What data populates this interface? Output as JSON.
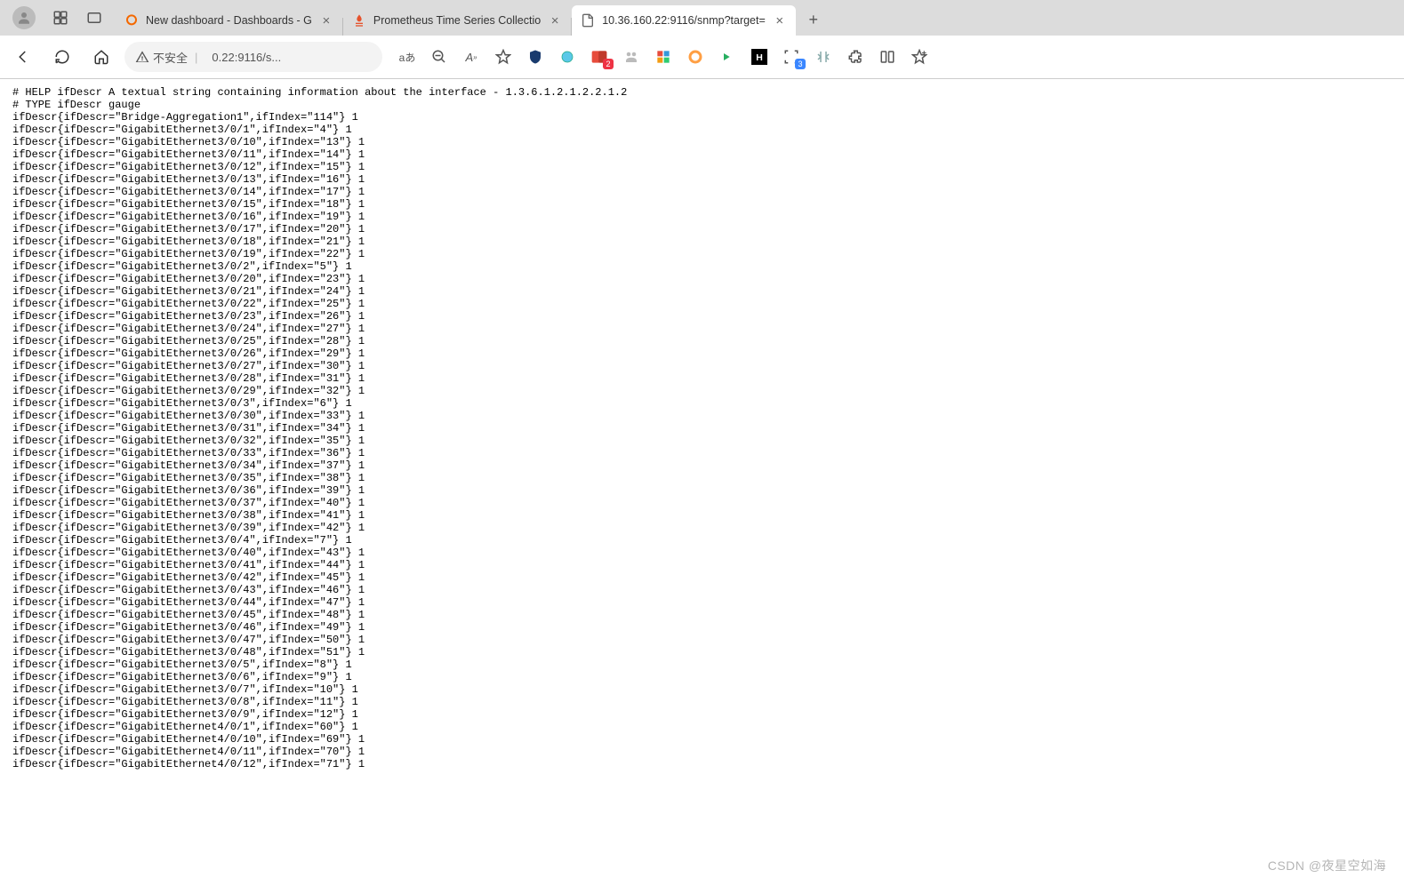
{
  "tabs": [
    {
      "title": "New dashboard - Dashboards - G",
      "favicon": "grafana"
    },
    {
      "title": "Prometheus Time Series Collectio",
      "favicon": "prometheus"
    },
    {
      "title": "10.36.160.22:9116/snmp?target=",
      "favicon": "page",
      "active": true
    }
  ],
  "addressBar": {
    "warning": "不安全",
    "urlHidden": "   ",
    "urlVisible": "0.22:9116/s..."
  },
  "toolbarIcons": {
    "lang": "aあ"
  },
  "extBadges": {
    "red": "2",
    "blue": "3"
  },
  "metrics": {
    "helpLine": "# HELP ifDescr A textual string containing information about the interface - 1.3.6.1.2.1.2.2.1.2",
    "typeLine": "# TYPE ifDescr gauge",
    "entries": [
      {
        "ifDescr": "Bridge-Aggregation1",
        "ifIndex": "114",
        "value": "1"
      },
      {
        "ifDescr": "GigabitEthernet3/0/1",
        "ifIndex": "4",
        "value": "1"
      },
      {
        "ifDescr": "GigabitEthernet3/0/10",
        "ifIndex": "13",
        "value": "1"
      },
      {
        "ifDescr": "GigabitEthernet3/0/11",
        "ifIndex": "14",
        "value": "1"
      },
      {
        "ifDescr": "GigabitEthernet3/0/12",
        "ifIndex": "15",
        "value": "1"
      },
      {
        "ifDescr": "GigabitEthernet3/0/13",
        "ifIndex": "16",
        "value": "1"
      },
      {
        "ifDescr": "GigabitEthernet3/0/14",
        "ifIndex": "17",
        "value": "1"
      },
      {
        "ifDescr": "GigabitEthernet3/0/15",
        "ifIndex": "18",
        "value": "1"
      },
      {
        "ifDescr": "GigabitEthernet3/0/16",
        "ifIndex": "19",
        "value": "1"
      },
      {
        "ifDescr": "GigabitEthernet3/0/17",
        "ifIndex": "20",
        "value": "1"
      },
      {
        "ifDescr": "GigabitEthernet3/0/18",
        "ifIndex": "21",
        "value": "1"
      },
      {
        "ifDescr": "GigabitEthernet3/0/19",
        "ifIndex": "22",
        "value": "1"
      },
      {
        "ifDescr": "GigabitEthernet3/0/2",
        "ifIndex": "5",
        "value": "1"
      },
      {
        "ifDescr": "GigabitEthernet3/0/20",
        "ifIndex": "23",
        "value": "1"
      },
      {
        "ifDescr": "GigabitEthernet3/0/21",
        "ifIndex": "24",
        "value": "1"
      },
      {
        "ifDescr": "GigabitEthernet3/0/22",
        "ifIndex": "25",
        "value": "1"
      },
      {
        "ifDescr": "GigabitEthernet3/0/23",
        "ifIndex": "26",
        "value": "1"
      },
      {
        "ifDescr": "GigabitEthernet3/0/24",
        "ifIndex": "27",
        "value": "1"
      },
      {
        "ifDescr": "GigabitEthernet3/0/25",
        "ifIndex": "28",
        "value": "1"
      },
      {
        "ifDescr": "GigabitEthernet3/0/26",
        "ifIndex": "29",
        "value": "1"
      },
      {
        "ifDescr": "GigabitEthernet3/0/27",
        "ifIndex": "30",
        "value": "1"
      },
      {
        "ifDescr": "GigabitEthernet3/0/28",
        "ifIndex": "31",
        "value": "1"
      },
      {
        "ifDescr": "GigabitEthernet3/0/29",
        "ifIndex": "32",
        "value": "1"
      },
      {
        "ifDescr": "GigabitEthernet3/0/3",
        "ifIndex": "6",
        "value": "1"
      },
      {
        "ifDescr": "GigabitEthernet3/0/30",
        "ifIndex": "33",
        "value": "1"
      },
      {
        "ifDescr": "GigabitEthernet3/0/31",
        "ifIndex": "34",
        "value": "1"
      },
      {
        "ifDescr": "GigabitEthernet3/0/32",
        "ifIndex": "35",
        "value": "1"
      },
      {
        "ifDescr": "GigabitEthernet3/0/33",
        "ifIndex": "36",
        "value": "1"
      },
      {
        "ifDescr": "GigabitEthernet3/0/34",
        "ifIndex": "37",
        "value": "1"
      },
      {
        "ifDescr": "GigabitEthernet3/0/35",
        "ifIndex": "38",
        "value": "1"
      },
      {
        "ifDescr": "GigabitEthernet3/0/36",
        "ifIndex": "39",
        "value": "1"
      },
      {
        "ifDescr": "GigabitEthernet3/0/37",
        "ifIndex": "40",
        "value": "1"
      },
      {
        "ifDescr": "GigabitEthernet3/0/38",
        "ifIndex": "41",
        "value": "1"
      },
      {
        "ifDescr": "GigabitEthernet3/0/39",
        "ifIndex": "42",
        "value": "1"
      },
      {
        "ifDescr": "GigabitEthernet3/0/4",
        "ifIndex": "7",
        "value": "1"
      },
      {
        "ifDescr": "GigabitEthernet3/0/40",
        "ifIndex": "43",
        "value": "1"
      },
      {
        "ifDescr": "GigabitEthernet3/0/41",
        "ifIndex": "44",
        "value": "1"
      },
      {
        "ifDescr": "GigabitEthernet3/0/42",
        "ifIndex": "45",
        "value": "1"
      },
      {
        "ifDescr": "GigabitEthernet3/0/43",
        "ifIndex": "46",
        "value": "1"
      },
      {
        "ifDescr": "GigabitEthernet3/0/44",
        "ifIndex": "47",
        "value": "1"
      },
      {
        "ifDescr": "GigabitEthernet3/0/45",
        "ifIndex": "48",
        "value": "1"
      },
      {
        "ifDescr": "GigabitEthernet3/0/46",
        "ifIndex": "49",
        "value": "1"
      },
      {
        "ifDescr": "GigabitEthernet3/0/47",
        "ifIndex": "50",
        "value": "1"
      },
      {
        "ifDescr": "GigabitEthernet3/0/48",
        "ifIndex": "51",
        "value": "1"
      },
      {
        "ifDescr": "GigabitEthernet3/0/5",
        "ifIndex": "8",
        "value": "1"
      },
      {
        "ifDescr": "GigabitEthernet3/0/6",
        "ifIndex": "9",
        "value": "1"
      },
      {
        "ifDescr": "GigabitEthernet3/0/7",
        "ifIndex": "10",
        "value": "1"
      },
      {
        "ifDescr": "GigabitEthernet3/0/8",
        "ifIndex": "11",
        "value": "1"
      },
      {
        "ifDescr": "GigabitEthernet3/0/9",
        "ifIndex": "12",
        "value": "1"
      },
      {
        "ifDescr": "GigabitEthernet4/0/1",
        "ifIndex": "60",
        "value": "1"
      },
      {
        "ifDescr": "GigabitEthernet4/0/10",
        "ifIndex": "69",
        "value": "1"
      },
      {
        "ifDescr": "GigabitEthernet4/0/11",
        "ifIndex": "70",
        "value": "1"
      },
      {
        "ifDescr": "GigabitEthernet4/0/12",
        "ifIndex": "71",
        "value": "1"
      }
    ]
  },
  "watermark": "CSDN @夜星空如海"
}
